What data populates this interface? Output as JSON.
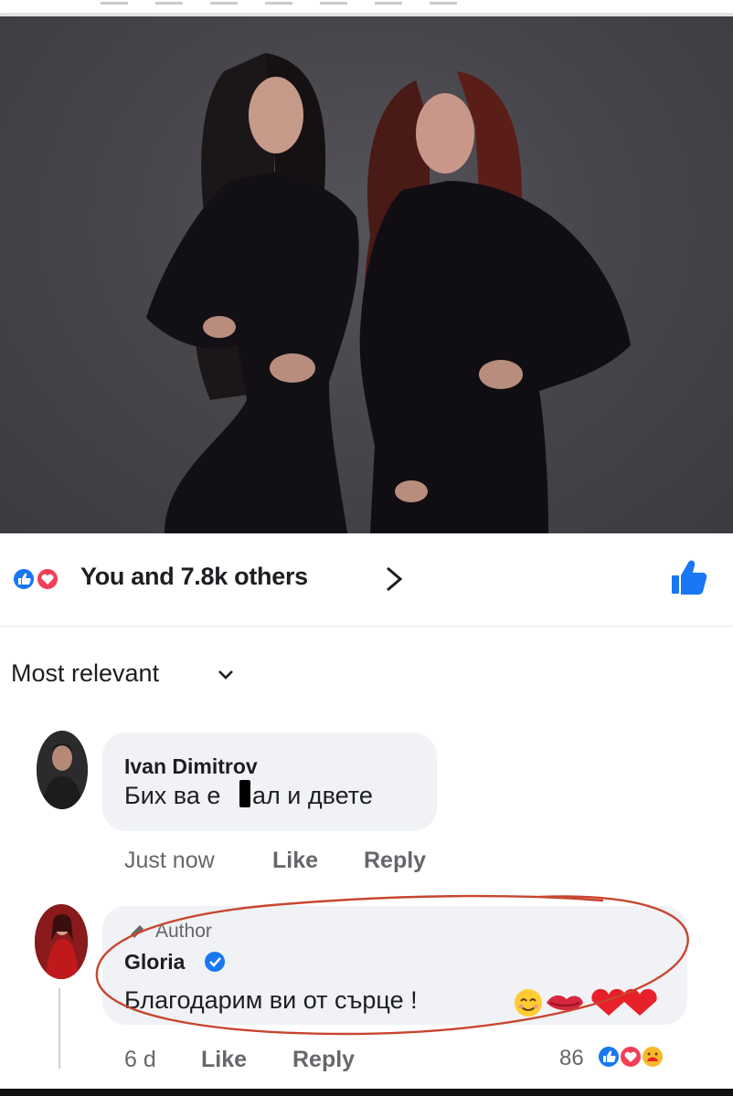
{
  "post": {
    "reactions_summary": "You and 7.8k others"
  },
  "comments_header": {
    "sort_label": "Most relevant"
  },
  "comments": [
    {
      "author": "Ivan Dimitrov",
      "text_before": "Бих ва е",
      "text_after": "ал и двете",
      "time": "Just now",
      "like_label": "Like",
      "reply_label": "Reply"
    },
    {
      "badge": "Author",
      "author": "Gloria",
      "text": "Благодарим ви от сърце !",
      "time": "6 d",
      "like_label": "Like",
      "reply_label": "Reply",
      "reaction_count": "86"
    }
  ],
  "icons": {
    "reaction_like": "like-reaction-icon",
    "reaction_love": "love-reaction-icon",
    "reaction_care": "care-reaction-icon",
    "verified": "verified-badge-icon",
    "author_badge": "pencil-icon"
  },
  "colors": {
    "facebook_blue": "#1877f2",
    "love_red": "#f33e58",
    "bubble_gray": "#f0f2f5",
    "meta_gray": "#65676b",
    "annotation_red": "#c8452f"
  }
}
